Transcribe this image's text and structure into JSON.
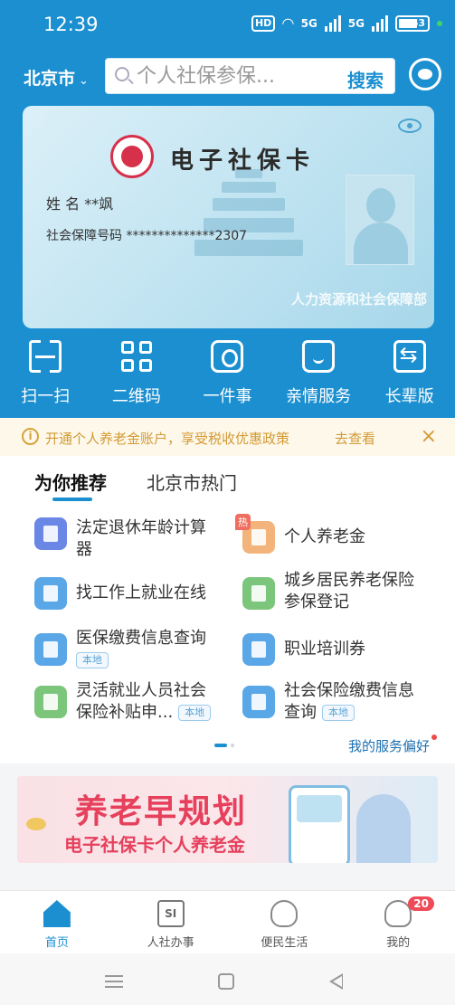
{
  "status_bar": {
    "time": "12:39",
    "network": "5G",
    "hd": "HD",
    "battery": "63"
  },
  "header": {
    "city": "北京市",
    "search_placeholder": "个人社保参保...",
    "search_button": "搜索",
    "customer_service_icon": "headset-icon"
  },
  "card": {
    "title": "电子社保卡",
    "name_label": "姓 名",
    "name_value": "**飒",
    "ssn_label": "社会保障号码",
    "ssn_value": "**************2307",
    "issuer": "人力资源和社会保障部"
  },
  "quick_actions": [
    {
      "label": "扫一扫",
      "icon": "scan-icon"
    },
    {
      "label": "二维码",
      "icon": "qrcode-icon"
    },
    {
      "label": "一件事",
      "icon": "one-thing-icon"
    },
    {
      "label": "亲情服务",
      "icon": "family-service-icon"
    },
    {
      "label": "长辈版",
      "icon": "elder-mode-icon"
    }
  ],
  "notice": {
    "text": "开通个人养老金账户，享受税收优惠政策",
    "link": "去查看"
  },
  "recommend": {
    "tabs": [
      "为你推荐",
      "北京市热门"
    ],
    "items": [
      {
        "label_line1": "法定退休年龄计算",
        "label_line2": "器",
        "icon": "calculator-icon",
        "color": "#6a87e6"
      },
      {
        "label_line1": "个人养老金",
        "hot_badge": "热",
        "icon": "piggy-bank-icon",
        "color": "#f3b47c"
      },
      {
        "label_line1": "找工作上就业在线",
        "icon": "document-icon",
        "color": "#5aa7e8"
      },
      {
        "label_line1": "城乡居民养老保险",
        "label_line2": "参保登记",
        "icon": "elder-person-icon",
        "color": "#7cc67c"
      },
      {
        "label_line1": "医保缴费信息查询",
        "tag": "本地",
        "icon": "medical-card-icon",
        "color": "#5aa7e8"
      },
      {
        "label_line1": "职业培训券",
        "icon": "ticket-icon",
        "color": "#5aa7e8"
      },
      {
        "label_line1": "灵活就业人员社会",
        "label_line2": "保险补贴申...",
        "tag": "本地",
        "icon": "money-bag-icon",
        "color": "#7cc67c"
      },
      {
        "label_line1": "社会保险缴费信息",
        "label_line2": "查询",
        "tag": "本地",
        "icon": "search-document-icon",
        "color": "#5aa7e8"
      }
    ],
    "preference_link": "我的服务偏好"
  },
  "banner": {
    "title": "养老早规划",
    "subtitle": "电子社保卡个人养老金"
  },
  "bottom_nav": [
    {
      "label": "首页",
      "icon": "home-icon",
      "active": true
    },
    {
      "label": "人社办事",
      "icon": "si-icon",
      "icon_text": "SI"
    },
    {
      "label": "便民生活",
      "icon": "handshake-icon"
    },
    {
      "label": "我的",
      "icon": "profile-icon",
      "badge": "20"
    }
  ],
  "colors": {
    "primary": "#1b8fd0",
    "notice": "#d39a34",
    "banner_red": "#e6405c"
  }
}
